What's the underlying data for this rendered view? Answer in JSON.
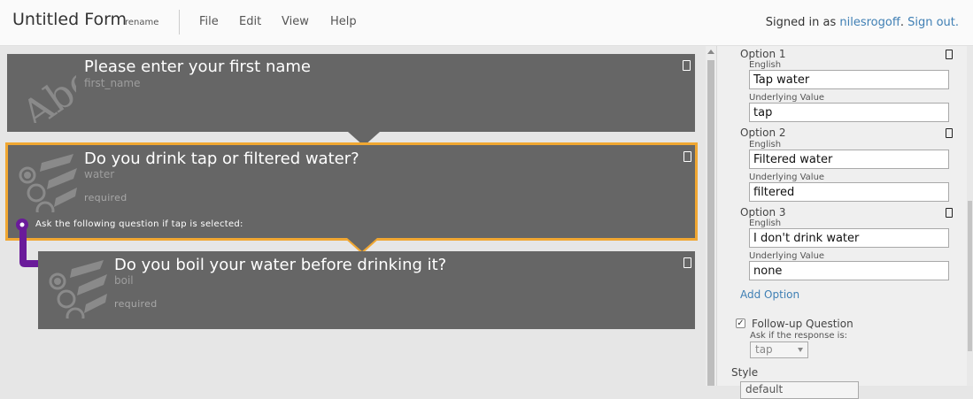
{
  "header": {
    "form_title": "Untitled Form",
    "rename_label": "rename",
    "menu": [
      "File",
      "Edit",
      "View",
      "Help"
    ],
    "signed_in_prefix": "Signed in as",
    "username": "nilesrogoff",
    "signout_label": "Sign out."
  },
  "questions": [
    {
      "title": "Please enter your first name",
      "varname": "first_name",
      "icon": "text-abc-icon"
    },
    {
      "title": "Do you drink tap or filtered water?",
      "varname": "water",
      "required": "required",
      "condition": "Ask the following question if tap is selected:",
      "icon": "multiple-choice-icon"
    },
    {
      "title": "Do you boil your water before drinking it?",
      "varname": "boil",
      "required": "required",
      "icon": "multiple-choice-icon"
    }
  ],
  "panel": {
    "options": [
      {
        "label": "Option 1",
        "english_label": "English",
        "english_value": "Tap water",
        "underlying_label": "Underlying Value",
        "underlying_value": "tap"
      },
      {
        "label": "Option 2",
        "english_label": "English",
        "english_value": "Filtered water",
        "underlying_label": "Underlying Value",
        "underlying_value": "filtered"
      },
      {
        "label": "Option 3",
        "english_label": "English",
        "english_value": "I don't drink water",
        "underlying_label": "Underlying Value",
        "underlying_value": "none"
      }
    ],
    "add_option": "Add Option",
    "followup_label": "Follow-up Question",
    "followup_checked": true,
    "ask_if_label": "Ask if the response is:",
    "ask_if_value": "tap",
    "style_label": "Style",
    "style_value": "default"
  },
  "colors": {
    "card_bg": "#666666",
    "selected_border": "#f0a732",
    "link": "#3f7fb4",
    "followup_connector": "#6a1b9a"
  }
}
